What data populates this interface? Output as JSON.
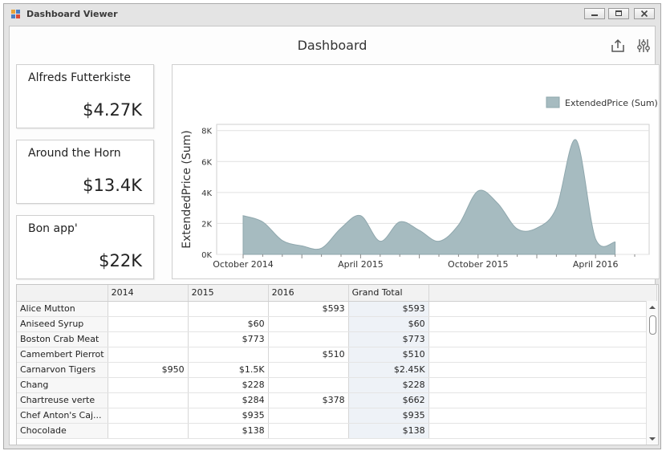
{
  "window": {
    "title": "Dashboard Viewer"
  },
  "dashboard": {
    "title": "Dashboard"
  },
  "header_icons": [
    "export-icon",
    "parameters-icon"
  ],
  "cards": [
    {
      "name": "Alfreds Futterkiste",
      "value": "$4.27K"
    },
    {
      "name": "Around the Horn",
      "value": "$13.4K"
    },
    {
      "name": "Bon app'",
      "value": "$22K"
    }
  ],
  "chart_data": {
    "type": "area",
    "ylabel": "ExtendedPrice (Sum)",
    "legend": [
      "ExtendedPrice (Sum)"
    ],
    "legend_position": "top-right",
    "series_color": "#a6bbc0",
    "ylim": [
      0,
      8400
    ],
    "yticks": [
      "0K",
      "2K",
      "4K",
      "6K",
      "8K"
    ],
    "xticks": [
      "October 2014",
      "April 2015",
      "October 2015",
      "April 2016"
    ],
    "grid": true,
    "points": [
      {
        "x": "2014-10",
        "y": 2500
      },
      {
        "x": "2014-11",
        "y": 2100
      },
      {
        "x": "2014-12",
        "y": 900
      },
      {
        "x": "2015-01",
        "y": 550
      },
      {
        "x": "2015-02",
        "y": 400
      },
      {
        "x": "2015-03",
        "y": 1700
      },
      {
        "x": "2015-04",
        "y": 2500
      },
      {
        "x": "2015-05",
        "y": 850
      },
      {
        "x": "2015-06",
        "y": 2100
      },
      {
        "x": "2015-07",
        "y": 1550
      },
      {
        "x": "2015-08",
        "y": 850
      },
      {
        "x": "2015-09",
        "y": 1900
      },
      {
        "x": "2015-10",
        "y": 4100
      },
      {
        "x": "2015-11",
        "y": 3300
      },
      {
        "x": "2015-12",
        "y": 1650
      },
      {
        "x": "2016-01",
        "y": 1700
      },
      {
        "x": "2016-02",
        "y": 3000
      },
      {
        "x": "2016-03",
        "y": 7400
      },
      {
        "x": "2016-04",
        "y": 1000
      },
      {
        "x": "2016-05",
        "y": 800
      }
    ]
  },
  "grid": {
    "columns": [
      "",
      "2014",
      "2015",
      "2016",
      "Grand Total"
    ],
    "rows": [
      {
        "name": "Alice Mutton",
        "y2014": "",
        "y2015": "",
        "y2016": "$593",
        "total": "$593"
      },
      {
        "name": "Aniseed Syrup",
        "y2014": "",
        "y2015": "$60",
        "y2016": "",
        "total": "$60"
      },
      {
        "name": "Boston Crab Meat",
        "y2014": "",
        "y2015": "$773",
        "y2016": "",
        "total": "$773"
      },
      {
        "name": "Camembert Pierrot",
        "y2014": "",
        "y2015": "",
        "y2016": "$510",
        "total": "$510"
      },
      {
        "name": "Carnarvon Tigers",
        "y2014": "$950",
        "y2015": "$1.5K",
        "y2016": "",
        "total": "$2.45K"
      },
      {
        "name": "Chang",
        "y2014": "",
        "y2015": "$228",
        "y2016": "",
        "total": "$228"
      },
      {
        "name": "Chartreuse verte",
        "y2014": "",
        "y2015": "$284",
        "y2016": "$378",
        "total": "$662"
      },
      {
        "name": "Chef Anton's Caj...",
        "y2014": "",
        "y2015": "$935",
        "y2016": "",
        "total": "$935"
      },
      {
        "name": "Chocolade",
        "y2014": "",
        "y2015": "$138",
        "y2016": "",
        "total": "$138"
      }
    ]
  }
}
